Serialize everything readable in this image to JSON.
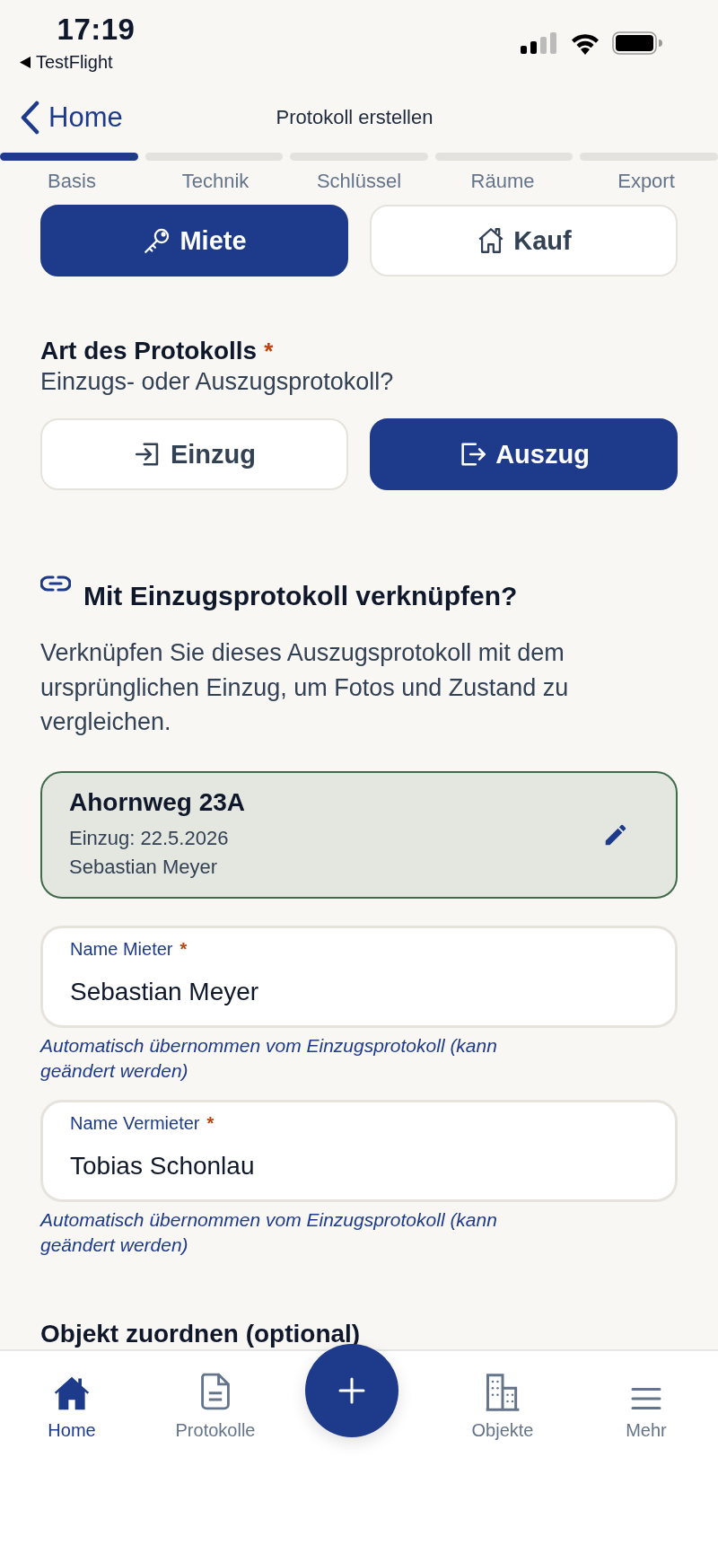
{
  "status_bar": {
    "time": "17:19",
    "back_app": "TestFlight"
  },
  "nav": {
    "back_label": "Home",
    "title": "Protokoll erstellen"
  },
  "steps": [
    {
      "label": "Basis",
      "selected": true
    },
    {
      "label": "Technik",
      "selected": false
    },
    {
      "label": "Schlüssel",
      "selected": false
    },
    {
      "label": "Räume",
      "selected": false
    },
    {
      "label": "Export",
      "selected": false
    }
  ],
  "contract_type": {
    "options": [
      {
        "label": "Miete",
        "selected": true
      },
      {
        "label": "Kauf",
        "selected": false
      }
    ]
  },
  "protocol_type": {
    "title": "Art des Protokolls",
    "required_mark": "*",
    "subtitle": "Einzugs- oder Auszugsprotokoll?",
    "options": [
      {
        "label": "Einzug",
        "selected": false
      },
      {
        "label": "Auszug",
        "selected": true
      }
    ]
  },
  "link_section": {
    "heading": "Mit Einzugsprotokoll verknüpfen?",
    "description": "Verknüpfen Sie dieses Auszugsprotokoll mit dem ursprünglichen Einzug, um Fotos und Zustand zu vergleichen."
  },
  "linked_entry": {
    "title": "Ahornweg 23A",
    "date": "Einzug: 22.5.2026",
    "tenant": "Sebastian Meyer"
  },
  "fields": [
    {
      "label": "Name Mieter",
      "required_mark": "*",
      "value": "Sebastian Meyer",
      "hint": "Automatisch übernommen vom Einzugsprotokoll (kann geändert werden)"
    },
    {
      "label": "Name Vermieter",
      "required_mark": "*",
      "value": "Tobias Schonlau",
      "hint": "Automatisch übernommen vom Einzugsprotokoll (kann geändert werden)"
    }
  ],
  "next_section": {
    "heading": "Objekt zuordnen (optional)"
  },
  "tab_bar": {
    "items": [
      {
        "label": "Home",
        "selected": true
      },
      {
        "label": "Protokolle",
        "selected": false
      },
      {
        "label": "Objekte",
        "selected": false
      },
      {
        "label": "Mehr",
        "selected": false
      }
    ]
  }
}
